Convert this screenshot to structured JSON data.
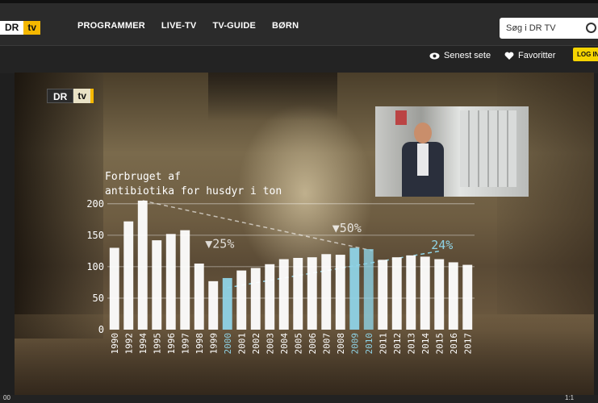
{
  "header": {
    "logo": {
      "dr": "DR",
      "tv": "tv"
    },
    "nav": [
      "PROGRAMMER",
      "LIVE-TV",
      "TV-GUIDE",
      "BØRN"
    ],
    "search_placeholder": "Søg i DR TV",
    "login": "LOG IN"
  },
  "subnav": {
    "recent": "Senest sete",
    "favorites": "Favoritter"
  },
  "video": {
    "logo": {
      "dr": "DR",
      "tv": "tv"
    }
  },
  "chart_data": {
    "type": "bar",
    "title": [
      "Forbruget af",
      "antibiotika for husdyr i ton"
    ],
    "categories": [
      "1990",
      "1992",
      "1994",
      "1995",
      "1996",
      "1997",
      "1998",
      "1999",
      "2000",
      "2001",
      "2002",
      "2003",
      "2004",
      "2005",
      "2006",
      "2007",
      "2008",
      "2009",
      "2010",
      "2011",
      "2012",
      "2013",
      "2014",
      "2015",
      "2016",
      "2017"
    ],
    "values": [
      130,
      172,
      205,
      142,
      152,
      158,
      105,
      77,
      82,
      94,
      98,
      104,
      112,
      114,
      115,
      120,
      119,
      130,
      128,
      111,
      115,
      118,
      116,
      112,
      107,
      103
    ],
    "highlighted": [
      "2000",
      "2009",
      "2010"
    ],
    "yticks": [
      0,
      50,
      100,
      150,
      200
    ],
    "ylim": [
      0,
      210
    ],
    "annotations": [
      {
        "label": "▼25%",
        "year": "1999"
      },
      {
        "label": "▼50%",
        "year": "2008"
      },
      {
        "label": "24%",
        "year": "2015"
      }
    ],
    "colors": {
      "bar": "#ffffff",
      "highlight": "#8fd3e6",
      "trend": "#8fd3e6"
    }
  },
  "bottombar": {
    "left": "00",
    "right": "1:1"
  }
}
